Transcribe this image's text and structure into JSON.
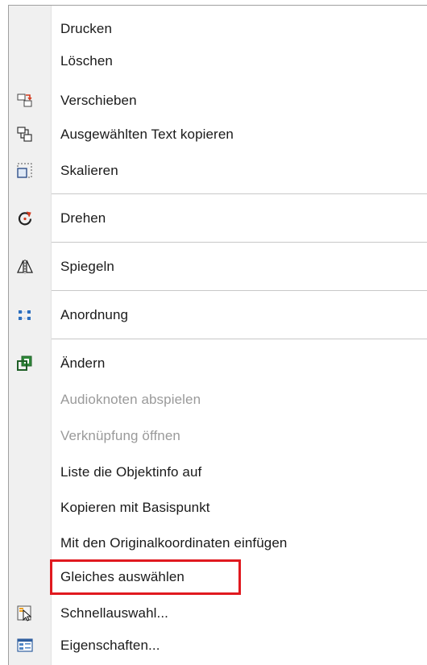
{
  "menu": {
    "items": [
      {
        "label": "Drucken",
        "icon": "",
        "enabled": true
      },
      {
        "label": "Löschen",
        "icon": "",
        "enabled": true
      },
      {
        "label": "Verschieben",
        "icon": "move-icon",
        "enabled": true
      },
      {
        "label": "Ausgewählten Text kopieren",
        "icon": "copy-selected-text-icon",
        "enabled": true
      },
      {
        "label": "Skalieren",
        "icon": "scale-icon",
        "enabled": true
      },
      {
        "label": "Drehen",
        "icon": "rotate-icon",
        "enabled": true
      },
      {
        "label": "Spiegeln",
        "icon": "mirror-icon",
        "enabled": true
      },
      {
        "label": "Anordnung",
        "icon": "array-icon",
        "enabled": true
      },
      {
        "label": "Ändern",
        "icon": "modify-icon",
        "enabled": true
      },
      {
        "label": "Audioknoten abspielen",
        "icon": "",
        "enabled": false
      },
      {
        "label": "Verknüpfung öffnen",
        "icon": "",
        "enabled": false
      },
      {
        "label": "Liste die Objektinfo auf",
        "icon": "",
        "enabled": true
      },
      {
        "label": "Kopieren mit Basispunkt",
        "icon": "",
        "enabled": true
      },
      {
        "label": "Mit den Originalkoordinaten einfügen",
        "icon": "",
        "enabled": true
      },
      {
        "label": "Gleiches auswählen",
        "icon": "",
        "enabled": true,
        "highlighted": true
      },
      {
        "label": "Schnellauswahl...",
        "icon": "quick-select-icon",
        "enabled": true
      },
      {
        "label": "Eigenschaften...",
        "icon": "properties-icon",
        "enabled": true
      }
    ]
  },
  "colors": {
    "highlight_border": "#e0191f",
    "disabled_text": "#9a9a9a",
    "text": "#1a1a1a"
  }
}
